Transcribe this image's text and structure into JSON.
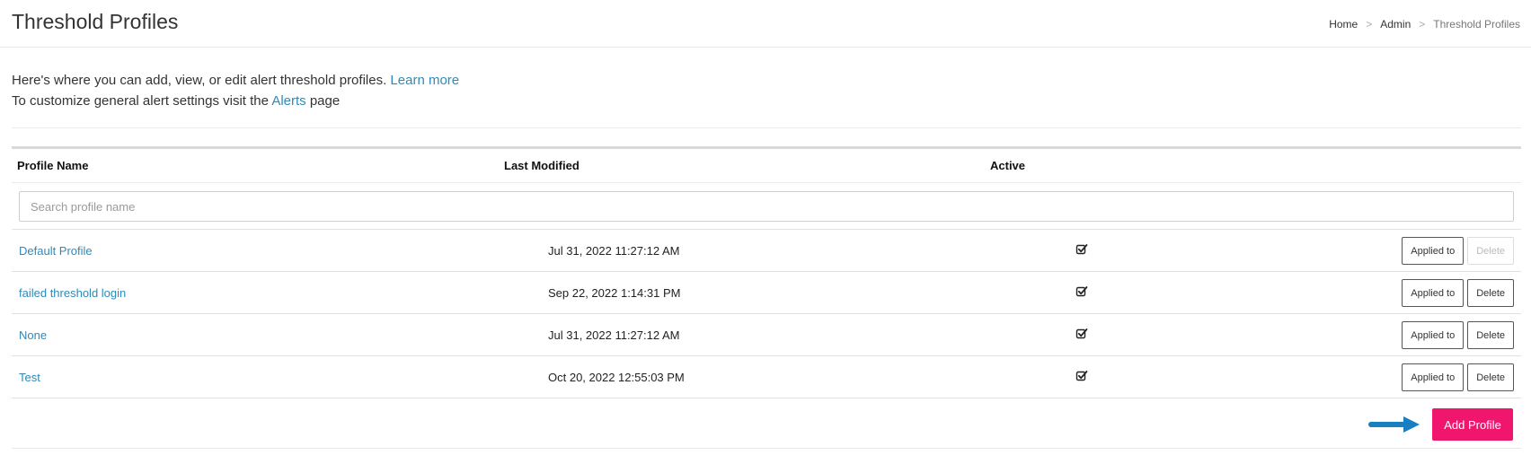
{
  "header": {
    "title": "Threshold Profiles",
    "breadcrumb": {
      "items": [
        "Home",
        "Admin"
      ],
      "current": "Threshold Profiles",
      "separator": ">"
    }
  },
  "intro": {
    "line1_text": "Here's where you can add, view, or edit alert threshold profiles.",
    "learn_more": "Learn more",
    "line2_prefix": "To customize general alert settings visit the",
    "alerts_link": "Alerts",
    "line2_suffix": "page"
  },
  "table": {
    "columns": [
      "Profile Name",
      "Last Modified",
      "Active"
    ],
    "search_placeholder": "Search profile name",
    "search_value": "",
    "rows": [
      {
        "name": "Default Profile",
        "last_modified": "Jul 31, 2022 11:27:12 AM",
        "active": true,
        "applied_label": "Applied to",
        "delete_label": "Delete",
        "delete_disabled": true
      },
      {
        "name": "failed threshold login",
        "last_modified": "Sep 22, 2022 1:14:31 PM",
        "active": true,
        "applied_label": "Applied to",
        "delete_label": "Delete",
        "delete_disabled": false
      },
      {
        "name": "None",
        "last_modified": "Jul 31, 2022 11:27:12 AM",
        "active": true,
        "applied_label": "Applied to",
        "delete_label": "Delete",
        "delete_disabled": false
      },
      {
        "name": "Test",
        "last_modified": "Oct 20, 2022 12:55:03 PM",
        "active": true,
        "applied_label": "Applied to",
        "delete_label": "Delete",
        "delete_disabled": false
      }
    ]
  },
  "footer": {
    "add_profile_label": "Add Profile",
    "annotation_icon": "arrow-right-icon"
  },
  "colors": {
    "link": "#2f8ab8",
    "accent": "#f0166e",
    "annotation_arrow": "#1a7fc1"
  }
}
